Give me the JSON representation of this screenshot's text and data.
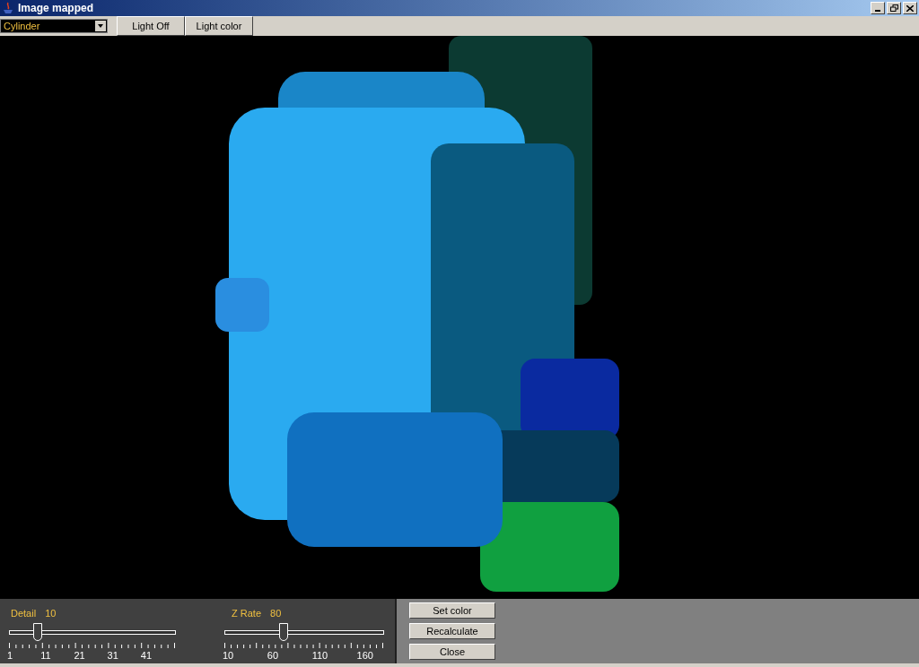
{
  "window": {
    "title": "Image mapped"
  },
  "toolbar": {
    "shape_dropdown": {
      "value": "Cylinder"
    },
    "buttons": [
      "Light Off",
      "Light color"
    ]
  },
  "sliders": [
    {
      "label": "Detail",
      "value": "10",
      "level": 0.17,
      "tick_labels": [
        "1",
        "11",
        "21",
        "31",
        "41"
      ]
    },
    {
      "label": "Z Rate",
      "value": "80",
      "level": 0.37,
      "tick_labels": [
        "10",
        "60",
        "110",
        "160"
      ]
    }
  ],
  "buttons": [
    "Set color",
    "Recalculate",
    "Close"
  ]
}
